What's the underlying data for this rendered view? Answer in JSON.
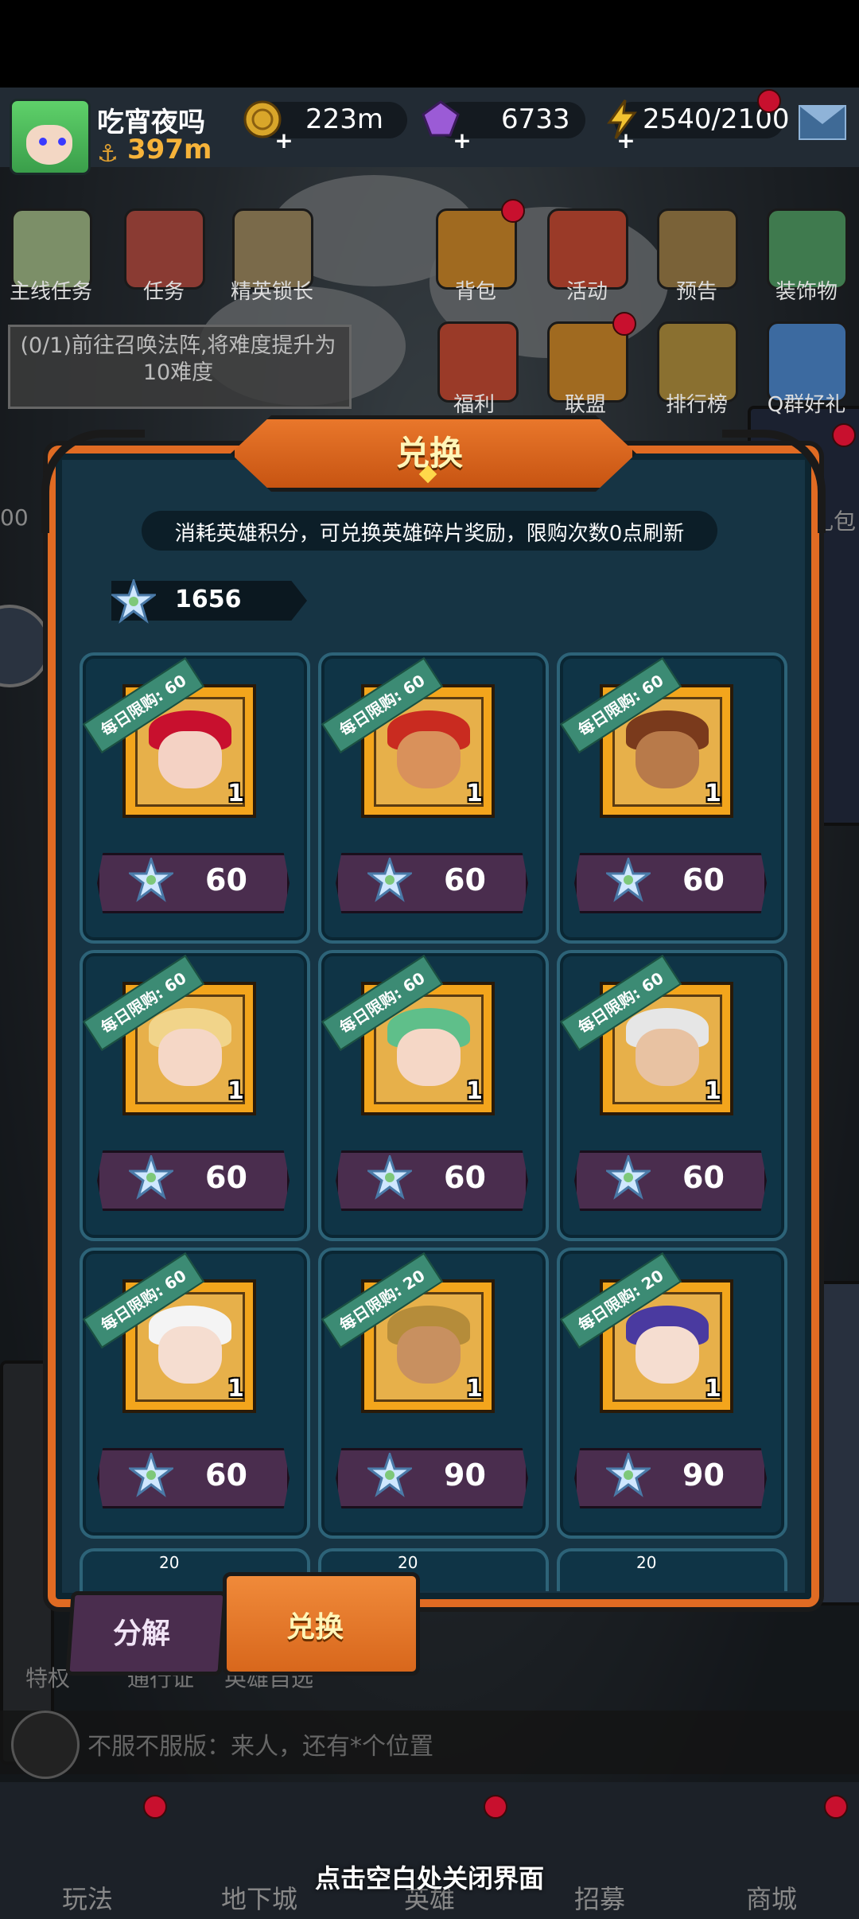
{
  "player": {
    "name": "吃宵夜吗",
    "power": "397m"
  },
  "resources": {
    "gold": "223m",
    "gems": "6733",
    "energy": "2540/2100"
  },
  "menu": {
    "row1": [
      "主线任务",
      "任务",
      "精英锁长",
      "背包",
      "活动",
      "预告",
      "装饰物"
    ],
    "row2": [
      "福利",
      "联盟",
      "排行榜",
      "Q群好礼"
    ],
    "left_cut": "00",
    "right_cut": "礼包"
  },
  "quest": {
    "text": "(0/1)前往召唤法阵,将难度提升为10难度"
  },
  "dialog": {
    "title": "兑换",
    "description": "消耗英雄积分，可兑换英雄碎片奖励，限购次数0点刷新",
    "points": "1656",
    "items": [
      {
        "limit": "每日限购: 60",
        "qty": "1",
        "price": "60",
        "hero": "elf-pirate"
      },
      {
        "limit": "每日限购: 60",
        "qty": "1",
        "price": "60",
        "hero": "red-beard-warrior"
      },
      {
        "limit": "每日限购: 60",
        "qty": "1",
        "price": "60",
        "hero": "desert-archer"
      },
      {
        "limit": "每日限购: 60",
        "qty": "1",
        "price": "60",
        "hero": "blonde-girl-glasses"
      },
      {
        "limit": "每日限购: 60",
        "qty": "1",
        "price": "60",
        "hero": "crystal-knight"
      },
      {
        "limit": "每日限购: 60",
        "qty": "1",
        "price": "60",
        "hero": "old-sage"
      },
      {
        "limit": "每日限购: 60",
        "qty": "1",
        "price": "60",
        "hero": "maid-girl"
      },
      {
        "limit": "每日限购: 20",
        "qty": "1",
        "price": "90",
        "hero": "golden-paladin"
      },
      {
        "limit": "每日限购: 20",
        "qty": "1",
        "price": "90",
        "hero": "star-mage"
      }
    ],
    "partial_ribbons": [
      "20",
      "20",
      "20"
    ],
    "tabs": {
      "decompose": "分解",
      "exchange": "兑换"
    }
  },
  "chat": {
    "text": "不服不服版：来人，还有*个位置"
  },
  "bottom_nav": [
    "玩法",
    "地下城",
    "英雄",
    "招募",
    "商城"
  ],
  "under_tabs": [
    "特权",
    "通行证",
    "英雄自选"
  ],
  "close_hint": "点击空白处关闭界面",
  "colors": {
    "accent_orange": "#e06b23",
    "panel": "#163444",
    "price_bar": "#4a2d4e",
    "ribbon": "#3c8b74",
    "gold_text": "#f6b33a"
  }
}
